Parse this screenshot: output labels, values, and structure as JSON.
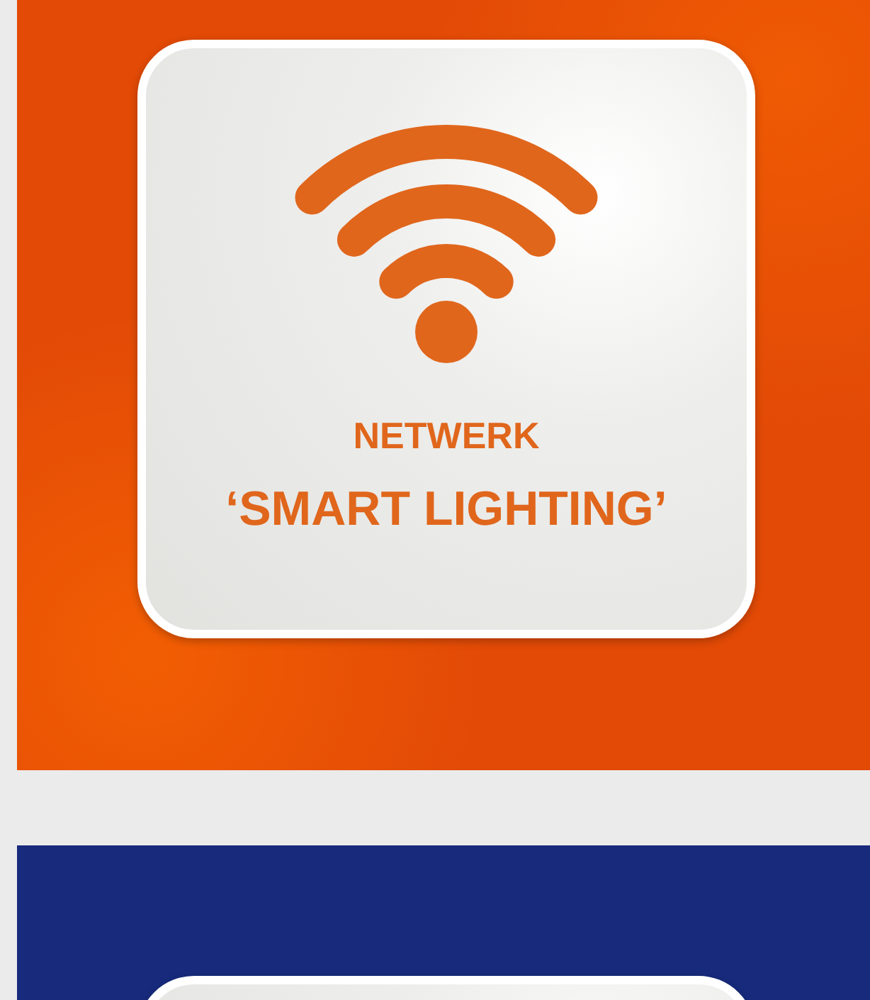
{
  "tiles": [
    {
      "color": "#e24a06",
      "heading": "NETWERK",
      "title": "‘SMART LIGHTING’"
    },
    {
      "color": "#172a7c"
    }
  ]
}
